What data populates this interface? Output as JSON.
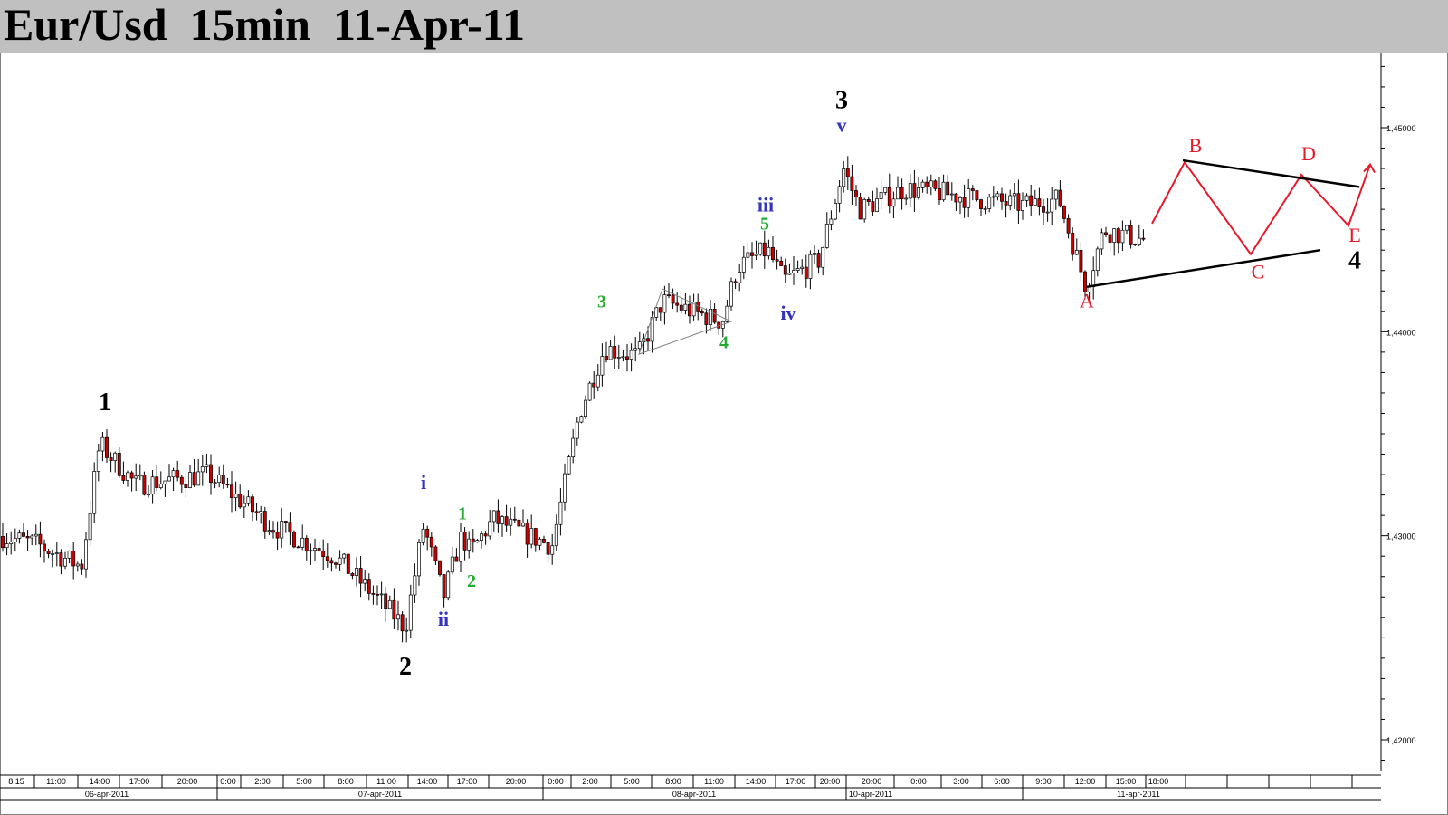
{
  "title": "Eur/Usd  15min  11-Apr-11",
  "colors": {
    "title_bg": "#c0c0c0",
    "bull_candle": "#ffffff",
    "bear_candle": "#cc0000",
    "wick": "#000000",
    "wave_black": "#000000",
    "wave_blue": "#3333bb",
    "wave_green": "#22aa33",
    "projection_red": "#e8182a"
  },
  "chart_data": {
    "type": "candlestick",
    "title": "Eur/Usd  15min  11-Apr-11",
    "y_ticks": [
      "1,42000",
      "1,43000",
      "1,44000",
      "1,45000"
    ],
    "ylim": [
      1.418,
      1.4535
    ],
    "x_time_ticks": [
      "8:15",
      "11:00",
      "14:00",
      "17:00",
      "20:00",
      "0:00",
      "2:00",
      "5:00",
      "8:00",
      "11:00",
      "14:00",
      "17:00",
      "20:00",
      "0:00",
      "2:00",
      "5:00",
      "8:00",
      "11:00",
      "14:00",
      "17:00",
      "20:00",
      "20:00",
      "0:00",
      "3:00",
      "6:00",
      "9:00",
      "12:00",
      "15:00",
      "18:00"
    ],
    "x_date_ticks": [
      "06-apr-2011",
      "07-apr-2011",
      "08-apr-2011",
      "10-apr-2011",
      "11-apr-2011"
    ],
    "price_path": [
      [
        0,
        1.43
      ],
      [
        40,
        1.4296
      ],
      [
        90,
        1.4285
      ],
      [
        110,
        1.4345
      ],
      [
        150,
        1.4325
      ],
      [
        230,
        1.433
      ],
      [
        300,
        1.4305
      ],
      [
        370,
        1.429
      ],
      [
        420,
        1.4268
      ],
      [
        448,
        1.4255
      ],
      [
        468,
        1.4305
      ],
      [
        490,
        1.427
      ],
      [
        510,
        1.43
      ],
      [
        520,
        1.4292
      ],
      [
        545,
        1.4308
      ],
      [
        610,
        1.4295
      ],
      [
        640,
        1.436
      ],
      [
        668,
        1.4392
      ],
      [
        705,
        1.4388
      ],
      [
        732,
        1.4415
      ],
      [
        798,
        1.4405
      ],
      [
        815,
        1.4432
      ],
      [
        848,
        1.444
      ],
      [
        866,
        1.4425
      ],
      [
        905,
        1.4435
      ],
      [
        932,
        1.448
      ],
      [
        950,
        1.446
      ],
      [
        1000,
        1.447
      ],
      [
        1040,
        1.4468
      ],
      [
        1080,
        1.4465
      ],
      [
        1130,
        1.4462
      ],
      [
        1170,
        1.4465
      ],
      [
        1200,
        1.4422
      ],
      [
        1220,
        1.445
      ],
      [
        1265,
        1.4445
      ]
    ],
    "waves": [
      {
        "label": "1",
        "group": "primary",
        "x": 116,
        "price": 1.43615
      },
      {
        "label": "2",
        "group": "primary",
        "x": 448,
        "price": 1.4232
      },
      {
        "label": "3",
        "group": "primary",
        "x": 930,
        "price": 1.45095
      },
      {
        "label": "4",
        "group": "primary",
        "x": 1497,
        "price": 1.4431
      },
      {
        "label": "i",
        "group": "minor",
        "x": 468,
        "price": 1.4323
      },
      {
        "label": "ii",
        "group": "minor",
        "x": 490,
        "price": 1.4256
      },
      {
        "label": "iii",
        "group": "minor",
        "x": 846,
        "price": 1.4459
      },
      {
        "label": "iv",
        "group": "minor",
        "x": 871,
        "price": 1.4406
      },
      {
        "label": "v",
        "group": "minor",
        "x": 930,
        "price": 1.4498
      },
      {
        "label": "1",
        "group": "minute",
        "x": 511,
        "price": 1.4308
      },
      {
        "label": "2",
        "group": "minute",
        "x": 521,
        "price": 1.4275
      },
      {
        "label": "3",
        "group": "minute",
        "x": 665,
        "price": 1.4412
      },
      {
        "label": "4",
        "group": "minute",
        "x": 800,
        "price": 1.4392
      },
      {
        "label": "5",
        "group": "minute",
        "x": 845,
        "price": 1.445
      }
    ],
    "projection": {
      "labels": [
        "A",
        "B",
        "C",
        "D",
        "E"
      ],
      "label_points": [
        [
          1201,
          1.4412
        ],
        [
          1321,
          1.4488
        ],
        [
          1390,
          1.4426
        ],
        [
          1446,
          1.4484
        ],
        [
          1497,
          1.4444
        ]
      ],
      "path": [
        [
          1273,
          1.4453
        ],
        [
          1309,
          1.4483
        ],
        [
          1382,
          1.4438
        ],
        [
          1438,
          1.4477
        ],
        [
          1490,
          1.4452
        ],
        [
          1514,
          1.4482
        ]
      ],
      "upper_line": [
        [
          1307,
          1.4484
        ],
        [
          1502,
          1.4471
        ]
      ],
      "lower_line": [
        [
          1201,
          1.4422
        ],
        [
          1459,
          1.444
        ]
      ],
      "triangle_small": [
        [
          732,
          1.4421
        ],
        [
          706,
          1.4389
        ],
        [
          808,
          1.4405
        ]
      ]
    }
  }
}
